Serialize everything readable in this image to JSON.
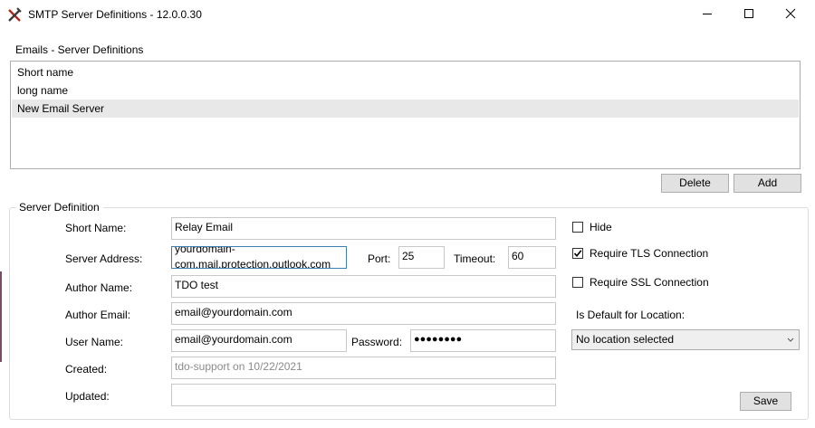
{
  "window": {
    "title": "SMTP Server Definitions - 12.0.0.30",
    "app_icon": "tools-x-icon",
    "controls": {
      "minimize": "minimize-icon",
      "maximize": "maximize-icon",
      "close": "close-icon"
    }
  },
  "server_list": {
    "label": "Emails - Server Definitions",
    "items": [
      {
        "label": "Short name"
      },
      {
        "label": "long name"
      },
      {
        "label": "New Email Server"
      }
    ],
    "selected_index": 2
  },
  "list_buttons": {
    "delete": "Delete",
    "add": "Add"
  },
  "server_definition": {
    "group_label": "Server Definition",
    "short_name": {
      "label": "Short Name:",
      "value": "Relay Email"
    },
    "server_address": {
      "label": "Server Address:",
      "value_line1": "yourdomain-",
      "value_line2": "com.mail.protection.outlook.com"
    },
    "port": {
      "label": "Port:",
      "value": "25"
    },
    "timeout": {
      "label": "Timeout:",
      "value": "60"
    },
    "author_name": {
      "label": "Author Name:",
      "value": "TDO test"
    },
    "author_email": {
      "label": "Author Email:",
      "value": "email@yourdomain.com"
    },
    "user_name": {
      "label": "User Name:",
      "value": "email@yourdomain.com"
    },
    "password": {
      "label": "Password:",
      "value": "●●●●●●●●"
    },
    "created": {
      "label": "Created:",
      "value": "tdo-support on 10/22/2021"
    },
    "updated": {
      "label": "Updated:",
      "value": ""
    },
    "hide": {
      "label": "Hide",
      "checked": false
    },
    "require_tls": {
      "label": "Require TLS Connection",
      "checked": true
    },
    "require_ssl": {
      "label": "Require SSL Connection",
      "checked": false
    },
    "default_location": {
      "label": "Is Default for Location:",
      "selected": "No location selected"
    },
    "save": "Save"
  },
  "colors": {
    "selection": "#e8e8e8",
    "button_face": "#e1e1e1",
    "border": "#adadad",
    "focus_border": "#3c7fb1"
  }
}
